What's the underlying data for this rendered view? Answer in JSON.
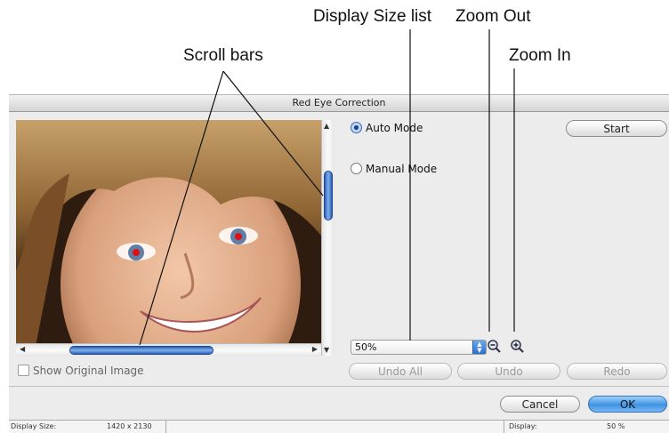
{
  "callouts": {
    "scroll_bars": "Scroll bars",
    "display_size_list": "Display Size list",
    "zoom_out": "Zoom Out",
    "zoom_in": "Zoom In"
  },
  "window": {
    "title": "Red Eye Correction"
  },
  "modes": {
    "auto_label": "Auto Mode",
    "manual_label": "Manual Mode",
    "selected": "auto"
  },
  "buttons": {
    "start": "Start",
    "undo_all": "Undo All",
    "undo": "Undo",
    "redo": "Redo",
    "cancel": "Cancel",
    "ok": "OK"
  },
  "display_select": {
    "value": "50%"
  },
  "zoom": {
    "out_icon": "zoom-out-icon",
    "in_icon": "zoom-in-icon"
  },
  "checkbox": {
    "label": "Show Original Image",
    "checked": false
  },
  "status": {
    "display_size_label": "Display Size:",
    "display_size_value": "1420 x 2130",
    "display_label": "Display:",
    "display_value": "50 %"
  },
  "colors": {
    "accent_blue": "#3f93e3",
    "window_bg": "#ececec"
  }
}
